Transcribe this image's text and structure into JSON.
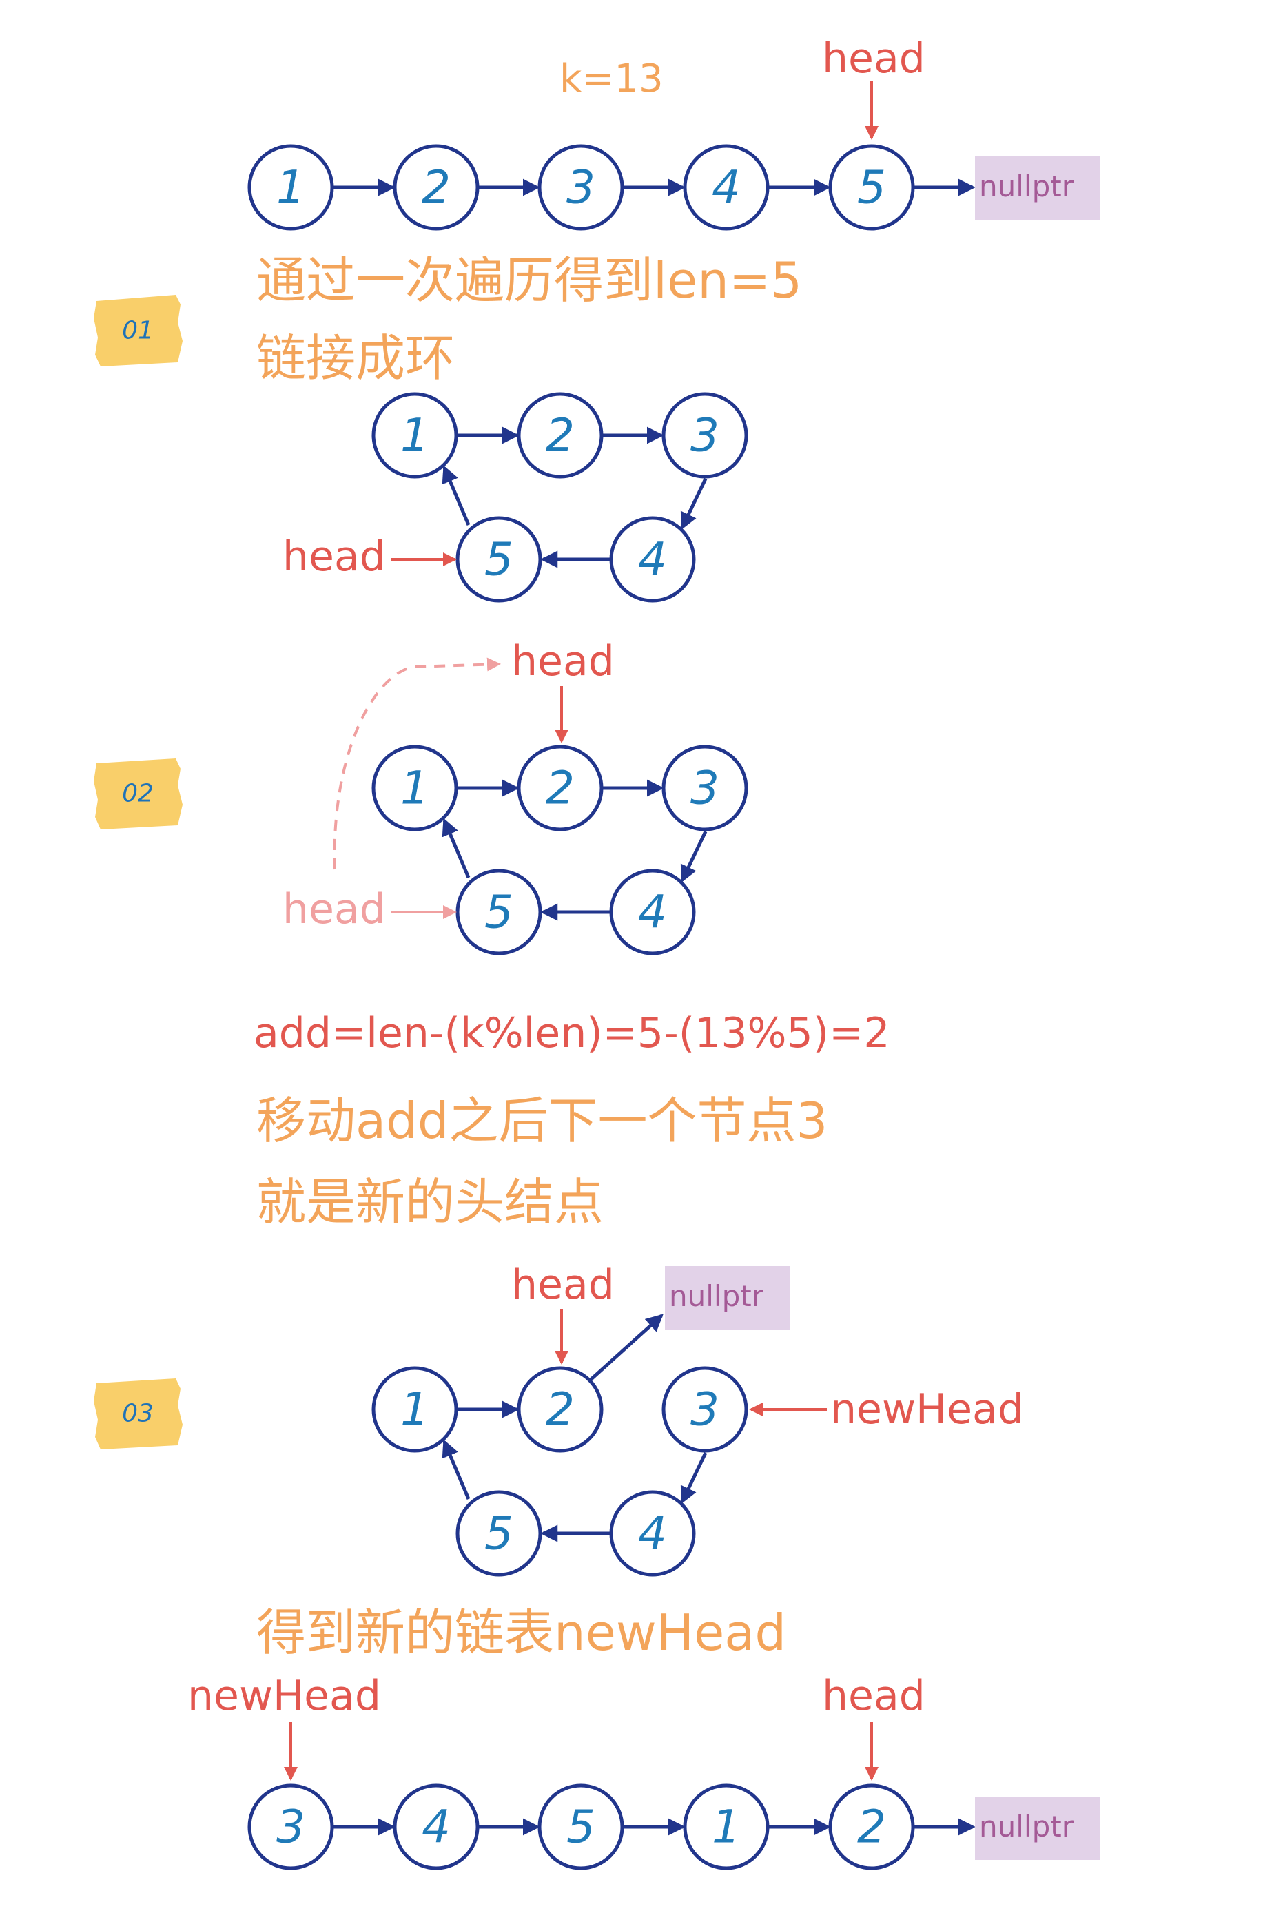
{
  "header": {
    "k_label": "k=13"
  },
  "pointers": {
    "head": "head",
    "new_head": "newHead"
  },
  "null_label": "nullptr",
  "badges": [
    "01",
    "02",
    "03"
  ],
  "top_list": [
    "1",
    "2",
    "3",
    "4",
    "5"
  ],
  "steps": {
    "s1_line1": "通过一次遍历得到len=5",
    "s1_line2": "链接成环",
    "formula": "add=len-(k%len)=5-(13%5)=2",
    "s3_line1": "移动add之后下一个节点3",
    "s3_line2": "就是新的头结点",
    "result_line": "得到新的链表newHead"
  },
  "ring_nodes": [
    "1",
    "2",
    "3",
    "4",
    "5"
  ],
  "bottom_list": [
    "3",
    "4",
    "5",
    "1",
    "2"
  ],
  "colors": {
    "node_stroke": "#21358c",
    "node_number": "#1f7ab8",
    "pointer_red": "#e2574f",
    "pointer_faint": "#f0a0a0",
    "text_orange": "#f3a45a",
    "null_box": "#e2d2e8",
    "badge_yellow": "#f9cf6a"
  }
}
